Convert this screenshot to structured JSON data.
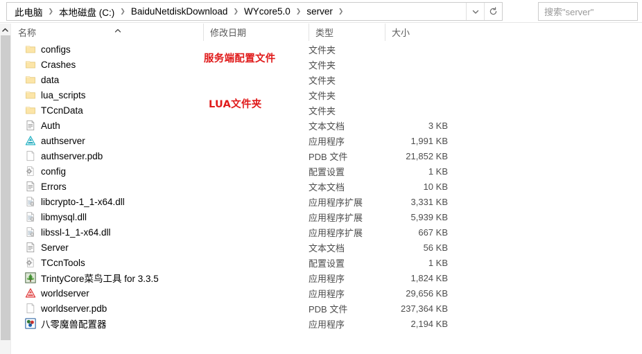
{
  "window": {
    "title": "server"
  },
  "address_bar": {
    "breadcrumbs": [
      {
        "label": "此电脑"
      },
      {
        "label": "本地磁盘 (C:)"
      },
      {
        "label": "BaiduNetdiskDownload"
      },
      {
        "label": "WYcore5.0"
      },
      {
        "label": "server"
      }
    ],
    "separator": "❯",
    "dropdown_icon": "chevron-down-icon",
    "refresh_icon": "refresh-icon"
  },
  "search": {
    "placeholder": "搜索\"server\""
  },
  "columns": {
    "name": "名称",
    "date_modified": "修改日期",
    "type": "类型",
    "size": "大小",
    "sort_column": "名称",
    "sort_direction": "ascending"
  },
  "annotations": [
    {
      "id": "configs",
      "text": "服务端配置文件",
      "color": "#e01b1b"
    },
    {
      "id": "lua",
      "text": "LUA文件夹",
      "color": "#e01b1b"
    }
  ],
  "files": [
    {
      "name": "configs",
      "icon": "folder-icon",
      "date": "",
      "type": "文件夹",
      "size": ""
    },
    {
      "name": "Crashes",
      "icon": "folder-icon",
      "date": "",
      "type": "文件夹",
      "size": ""
    },
    {
      "name": "data",
      "icon": "folder-icon",
      "date": "",
      "type": "文件夹",
      "size": ""
    },
    {
      "name": "lua_scripts",
      "icon": "folder-icon",
      "date": "",
      "type": "文件夹",
      "size": ""
    },
    {
      "name": "TCcnData",
      "icon": "folder-icon",
      "date": "",
      "type": "文件夹",
      "size": ""
    },
    {
      "name": "Auth",
      "icon": "text-document-icon",
      "date": "",
      "type": "文本文档",
      "size": "3 KB"
    },
    {
      "name": "authserver",
      "icon": "app-teal-icon",
      "date": "",
      "type": "应用程序",
      "size": "1,991 KB"
    },
    {
      "name": "authserver.pdb",
      "icon": "blank-page-icon",
      "date": "",
      "type": "PDB 文件",
      "size": "21,852 KB"
    },
    {
      "name": "config",
      "icon": "gear-page-icon",
      "date": "",
      "type": "配置设置",
      "size": "1 KB"
    },
    {
      "name": "Errors",
      "icon": "text-document-icon",
      "date": "",
      "type": "文本文档",
      "size": "10 KB"
    },
    {
      "name": "libcrypto-1_1-x64.dll",
      "icon": "dll-icon",
      "date": "",
      "type": "应用程序扩展",
      "size": "3,331 KB"
    },
    {
      "name": "libmysql.dll",
      "icon": "dll-icon",
      "date": "",
      "type": "应用程序扩展",
      "size": "5,939 KB"
    },
    {
      "name": "libssl-1_1-x64.dll",
      "icon": "dll-icon",
      "date": "",
      "type": "应用程序扩展",
      "size": "667 KB"
    },
    {
      "name": "Server",
      "icon": "text-document-icon",
      "date": "",
      "type": "文本文档",
      "size": "56 KB"
    },
    {
      "name": "TCcnTools",
      "icon": "gear-page-icon",
      "date": "",
      "type": "配置设置",
      "size": "1 KB"
    },
    {
      "name": "TrintyCore菜鸟工具 for 3.3.5",
      "icon": "green-tree-app-icon",
      "date": "",
      "type": "应用程序",
      "size": "1,824 KB"
    },
    {
      "name": "worldserver",
      "icon": "app-red-icon",
      "date": "",
      "type": "应用程序",
      "size": "29,656 KB"
    },
    {
      "name": "worldserver.pdb",
      "icon": "blank-page-icon",
      "date": "",
      "type": "PDB 文件",
      "size": "237,364 KB"
    },
    {
      "name": "八零魔兽配置器",
      "icon": "colorful-balls-app-icon",
      "date": "",
      "type": "应用程序",
      "size": "2,194 KB"
    }
  ],
  "scrollbar": {
    "up_arrow_icon": "chevron-up-icon",
    "orientation": "vertical"
  }
}
